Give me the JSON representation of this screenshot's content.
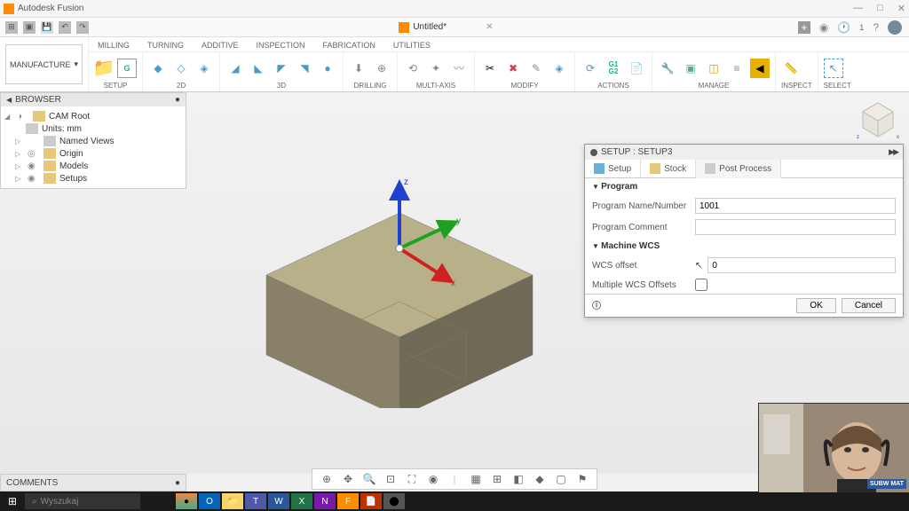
{
  "app_title": "Autodesk Fusion",
  "doc_title": "Untitled*",
  "ribbon": {
    "workspace": "MANUFACTURE",
    "tabs": [
      "MILLING",
      "TURNING",
      "ADDITIVE",
      "INSPECTION",
      "FABRICATION",
      "UTILITIES"
    ],
    "active_tab": "MILLING",
    "groups": [
      "SETUP",
      "2D",
      "3D",
      "DRILLING",
      "MULTI-AXIS",
      "MODIFY",
      "ACTIONS",
      "MANAGE",
      "INSPECT",
      "SELECT"
    ]
  },
  "browser": {
    "title": "BROWSER",
    "root": "CAM Root",
    "items": [
      "Units: mm",
      "Named Views",
      "Origin",
      "Models",
      "Setups"
    ]
  },
  "panel": {
    "title": "SETUP : SETUP3",
    "tabs": [
      "Setup",
      "Stock",
      "Post Process"
    ],
    "active_tab": "Post Process",
    "sections": {
      "program": {
        "title": "Program",
        "name_label": "Program Name/Number",
        "name_value": "1001",
        "comment_label": "Program Comment",
        "comment_value": ""
      },
      "wcs": {
        "title": "Machine WCS",
        "offset_label": "WCS offset",
        "offset_value": "0",
        "multi_label": "Multiple WCS Offsets",
        "multi_checked": false
      }
    },
    "ok": "OK",
    "cancel": "Cancel"
  },
  "comments_label": "COMMENTS",
  "taskbar_search": "Wyszukaj",
  "axes": {
    "x": "x",
    "y": "y",
    "z": "z"
  },
  "webcam_badge": "SUBW\nMAT"
}
